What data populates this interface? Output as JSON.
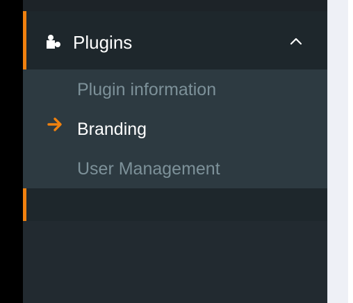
{
  "sidebar": {
    "group": {
      "label": "Plugins",
      "icon": "puzzle-icon",
      "expanded": true,
      "toggle_icon": "chevron-up-icon"
    },
    "items": [
      {
        "label": "Plugin information",
        "active": false
      },
      {
        "label": "Branding",
        "active": true,
        "indicator_icon": "arrow-right-icon"
      },
      {
        "label": "User Management",
        "active": false
      }
    ]
  },
  "colors": {
    "accent": "#f0810f",
    "sidebar_bg": "#222a30",
    "header_bg": "#1e272c",
    "submenu_bg": "#2d3a41",
    "active_text": "#ffffff",
    "inactive_text": "#7d9199"
  }
}
